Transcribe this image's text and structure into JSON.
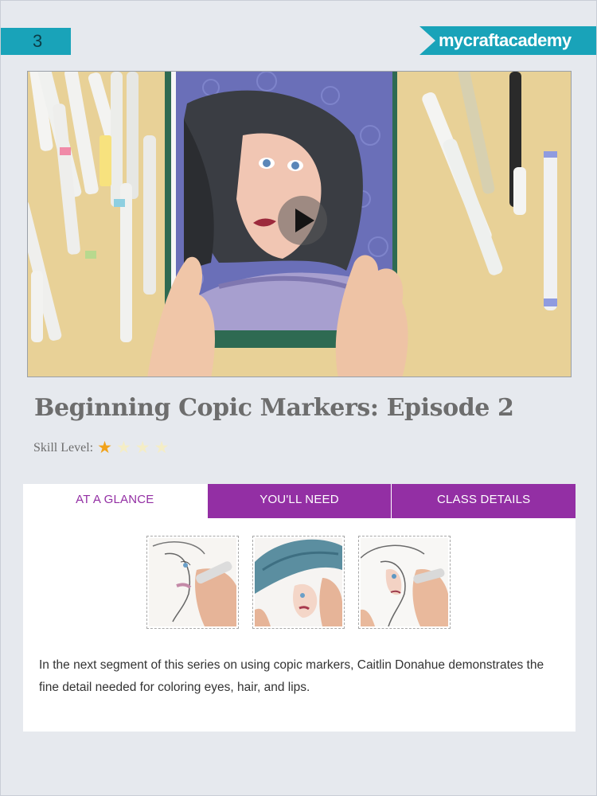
{
  "header": {
    "page_number": "3",
    "brand": "mycraftacademy"
  },
  "video": {
    "play_icon": "play-icon"
  },
  "class": {
    "title": "Beginning Copic Markers: Episode 2",
    "skill_label": "Skill Level:",
    "skill_rating": 1,
    "skill_max": 4
  },
  "tabs": [
    {
      "label": "AT A GLANCE",
      "active": true
    },
    {
      "label": "YOU'LL NEED",
      "active": false
    },
    {
      "label": "CLASS DETAILS",
      "active": false
    }
  ],
  "glance": {
    "description": "In the next segment of this series on using copic markers, Caitlin Donahue demonstrates the fine detail needed for coloring eyes, hair, and lips."
  },
  "colors": {
    "brand_teal": "#19a3b9",
    "tab_purple": "#932fa4",
    "star_on": "#f1a21a",
    "star_off": "#f4edc6"
  }
}
